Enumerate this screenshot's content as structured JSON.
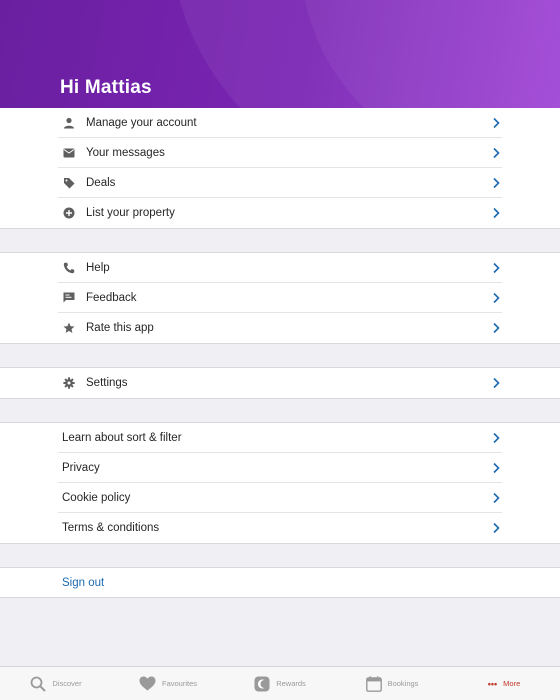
{
  "header": {
    "greeting": "Hi Mattias"
  },
  "groups": [
    {
      "items": [
        {
          "label": "Manage your account",
          "icon": "person-icon"
        },
        {
          "label": "Your messages",
          "icon": "mail-icon"
        },
        {
          "label": "Deals",
          "icon": "tag-icon"
        },
        {
          "label": "List your property",
          "icon": "add-circle-icon"
        }
      ]
    },
    {
      "items": [
        {
          "label": "Help",
          "icon": "phone-icon"
        },
        {
          "label": "Feedback",
          "icon": "feedback-icon"
        },
        {
          "label": "Rate this app",
          "icon": "star-icon"
        }
      ]
    },
    {
      "items": [
        {
          "label": "Settings",
          "icon": "gear-icon"
        }
      ]
    },
    {
      "items": [
        {
          "label": "Learn about sort & filter"
        },
        {
          "label": "Privacy"
        },
        {
          "label": "Cookie policy"
        },
        {
          "label": "Terms & conditions"
        }
      ]
    }
  ],
  "signout": {
    "label": "Sign out"
  },
  "tabbar": {
    "tabs": [
      {
        "label": "Discover",
        "icon": "search-icon"
      },
      {
        "label": "Favourites",
        "icon": "heart-icon"
      },
      {
        "label": "Rewards",
        "icon": "rewards-icon"
      },
      {
        "label": "Bookings",
        "icon": "calendar-icon"
      },
      {
        "label": "More",
        "icon": "more-dots-icon",
        "active": true
      }
    ]
  },
  "colors": {
    "header_start": "#6a1fa0",
    "header_end": "#9a3bd4",
    "chevron": "#1d6bb0",
    "signout": "#1d6bb0",
    "active_tab": "#c0392b"
  }
}
